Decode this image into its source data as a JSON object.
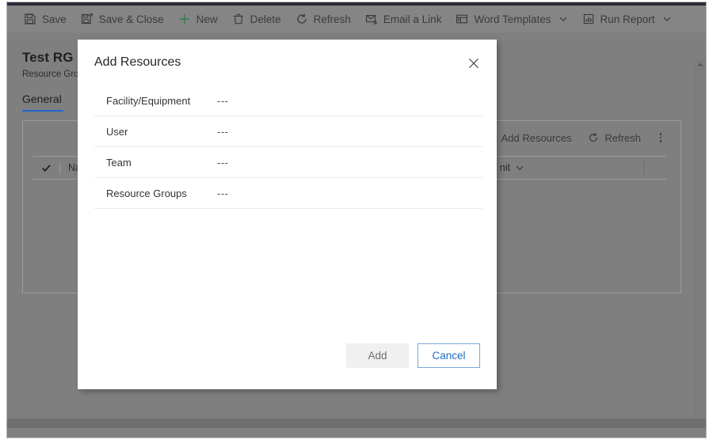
{
  "command_bar": {
    "items": [
      {
        "label": "Save",
        "icon": "save-icon",
        "has_chevron": false
      },
      {
        "label": "Save & Close",
        "icon": "save-close-icon",
        "has_chevron": false
      },
      {
        "label": "New",
        "icon": "plus-icon",
        "has_chevron": false
      },
      {
        "label": "Delete",
        "icon": "trash-icon",
        "has_chevron": false
      },
      {
        "label": "Refresh",
        "icon": "refresh-icon",
        "has_chevron": false
      },
      {
        "label": "Email a Link",
        "icon": "email-link-icon",
        "has_chevron": false
      },
      {
        "label": "Word Templates",
        "icon": "word-template-icon",
        "has_chevron": true
      },
      {
        "label": "Run Report",
        "icon": "report-icon",
        "has_chevron": true
      }
    ]
  },
  "record": {
    "title": "Test RG",
    "subtitle": "Resource Gro",
    "tabs": [
      {
        "label": "General",
        "active": true
      }
    ]
  },
  "grid": {
    "toolbar": [
      {
        "label": "Add Resources",
        "icon": "plus-icon"
      },
      {
        "label": "Refresh",
        "icon": "refresh-icon"
      }
    ],
    "overflow_label": "more-commands",
    "columns": [
      {
        "label": "Na",
        "has_chevron": false
      },
      {
        "label": "nit",
        "has_chevron": true
      }
    ],
    "select_all_icon": "checkmark-icon"
  },
  "dialog": {
    "title": "Add Resources",
    "close_icon": "close-icon",
    "rows": [
      {
        "label": "Facility/Equipment",
        "value": "---"
      },
      {
        "label": "User",
        "value": "---"
      },
      {
        "label": "Team",
        "value": "---"
      },
      {
        "label": "Resource Groups",
        "value": "---"
      }
    ],
    "buttons": {
      "add_label": "Add",
      "cancel_label": "Cancel"
    }
  },
  "colors": {
    "accent_blue": "#2266cc",
    "link_blue": "#1a6fc4",
    "dim_overlay": "#808080",
    "dialog_bg": "#ffffff",
    "divider": "#ebebeb"
  }
}
